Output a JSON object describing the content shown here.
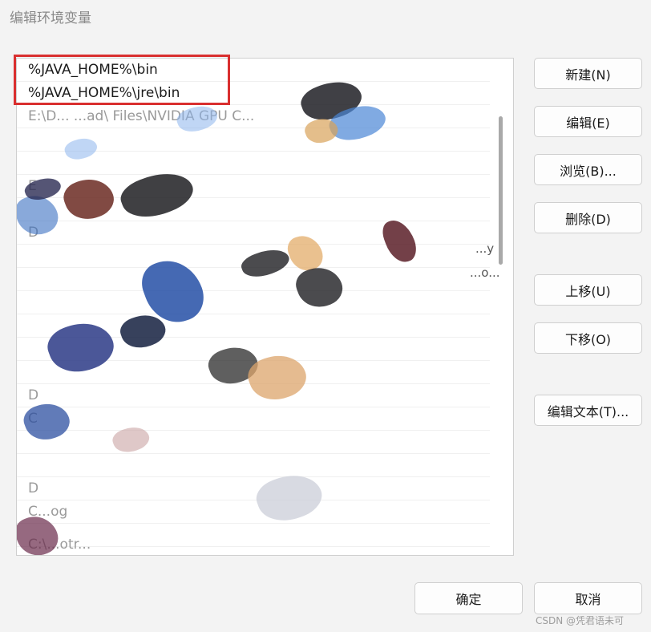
{
  "window": {
    "title": "编辑环境变量"
  },
  "list": {
    "items": [
      {
        "text": "%JAVA_HOME%\\bin",
        "style": "normal"
      },
      {
        "text": "%JAVA_HOME%\\jre\\bin",
        "style": "normal"
      },
      {
        "text": "E:\\D... ...ad\\ Files\\NVIDIA GPU C...",
        "style": "faded"
      },
      {
        "text": "",
        "style": "faded"
      },
      {
        "text": "",
        "style": "faded"
      },
      {
        "text": "E",
        "style": "faded"
      },
      {
        "text": "",
        "style": "faded"
      },
      {
        "text": "D",
        "style": "faded"
      },
      {
        "text": "",
        "style": "faded"
      },
      {
        "text": "",
        "style": "faded"
      },
      {
        "text": "",
        "style": "faded"
      },
      {
        "text": "",
        "style": "faded"
      },
      {
        "text": "",
        "style": "faded"
      },
      {
        "text": "",
        "style": "faded"
      },
      {
        "text": "D",
        "style": "faded"
      },
      {
        "text": "C",
        "style": "faded"
      },
      {
        "text": "",
        "style": "faded"
      },
      {
        "text": "",
        "style": "faded"
      },
      {
        "text": "D",
        "style": "faded"
      },
      {
        "text": "C...og",
        "style": "faded"
      },
      {
        "text": "",
        "style": "faded"
      },
      {
        "text": "C:\\...otr...",
        "style": "faded"
      }
    ],
    "side_text_1": "...y",
    "side_text_2": "...o..."
  },
  "buttons": {
    "new": "新建(N)",
    "edit": "编辑(E)",
    "browse": "浏览(B)...",
    "delete": "删除(D)",
    "move_up": "上移(U)",
    "move_down": "下移(O)",
    "edit_text": "编辑文本(T)...",
    "ok": "确定",
    "cancel": "取消"
  },
  "watermark": "CSDN @凭君语未可",
  "colors": {
    "highlight_border": "#d92f2f"
  }
}
